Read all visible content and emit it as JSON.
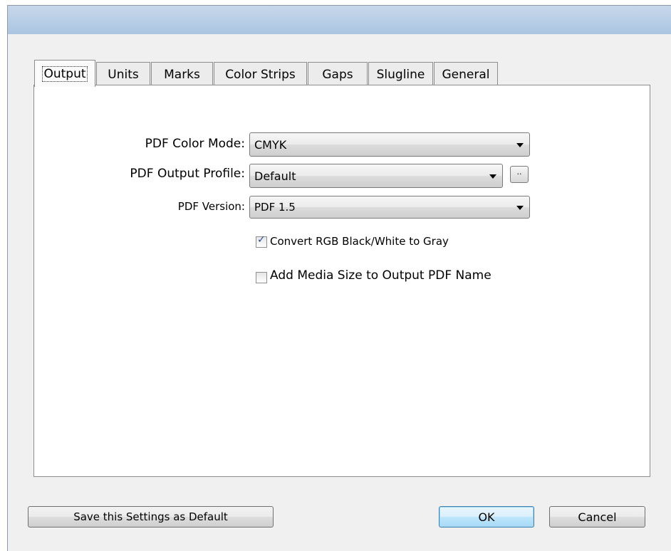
{
  "tabs": [
    {
      "label": "Output",
      "active": true
    },
    {
      "label": "Units"
    },
    {
      "label": "Marks"
    },
    {
      "label": "Color Strips"
    },
    {
      "label": "Gaps"
    },
    {
      "label": "Slugline"
    },
    {
      "label": "General"
    }
  ],
  "form": {
    "color_mode": {
      "label": "PDF Color Mode:",
      "value": "CMYK"
    },
    "output_profile": {
      "label": "PDF Output Profile:",
      "value": "Default",
      "browse_label": ".."
    },
    "version": {
      "label": "PDF Version:",
      "value": "PDF 1.5"
    },
    "convert_gray": {
      "label": "Convert RGB Black/White to Gray",
      "checked": true
    },
    "add_media_size": {
      "label": "Add Media Size to Output PDF Name",
      "checked": false
    }
  },
  "buttons": {
    "save_default": "Save this Settings as Default",
    "ok": "OK",
    "cancel": "Cancel"
  },
  "icons": {
    "checkmark": "✓",
    "dropdown": "chevron-down-icon"
  },
  "colors": {
    "titlebar": "#b6cde6",
    "accent": "#3c7fb1"
  }
}
